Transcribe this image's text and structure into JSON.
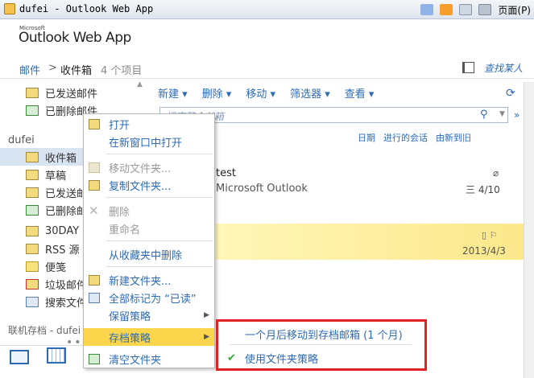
{
  "browser": {
    "tab_title": "dufei - Outlook Web App",
    "page_menu": "页面(P)"
  },
  "header": {
    "ms_label": "Microsoft",
    "brand": "Outlook Web App"
  },
  "breadcrumb": {
    "root": "邮件",
    "separator": ">",
    "current": "收件箱",
    "count": "4 个项目",
    "find_people": "查找某人"
  },
  "nav": {
    "favorites": [
      {
        "label": "已发送邮件"
      },
      {
        "label": "已删除邮件"
      }
    ],
    "account": "dufei",
    "folders": [
      {
        "label": "收件箱"
      },
      {
        "label": "草稿"
      },
      {
        "label": "已发送邮件"
      },
      {
        "label": "已删除邮件"
      },
      {
        "label": "30DAY"
      },
      {
        "label": "RSS 源"
      },
      {
        "label": "便笺"
      },
      {
        "label": "垃圾邮件"
      },
      {
        "label": "搜索文件夹"
      }
    ],
    "archive": "联机存档 - dufei"
  },
  "toolbar": {
    "new": "新建",
    "delete": "删除",
    "move": "移动",
    "filter": "筛选器",
    "view": "查看"
  },
  "search": {
    "placeholder": "搜索整个邮箱"
  },
  "sort": {
    "date": "日期",
    "conversations": "进行的会话",
    "order": "由新到旧"
  },
  "messages": [
    {
      "subject": "test",
      "from": "Microsoft Outlook",
      "date": "三 4/10"
    },
    {
      "date": "2013/4/3"
    }
  ],
  "context_menu": {
    "items": [
      {
        "label": "打开",
        "enabled": true
      },
      {
        "label": "在新窗口中打开",
        "enabled": true
      },
      {
        "label": "移动文件夹...",
        "enabled": false
      },
      {
        "label": "复制文件夹...",
        "enabled": true
      },
      {
        "label": "删除",
        "enabled": false
      },
      {
        "label": "重命名",
        "enabled": false
      },
      {
        "label": "从收藏夹中删除",
        "enabled": true
      },
      {
        "label": "新建文件夹...",
        "enabled": true
      },
      {
        "label": "全部标记为 “已读”",
        "enabled": true
      },
      {
        "label": "保留策略",
        "enabled": true
      },
      {
        "label": "存档策略",
        "enabled": true,
        "highlighted": true
      },
      {
        "label": "清空文件夹",
        "enabled": true
      }
    ]
  },
  "submenu": {
    "items": [
      {
        "label": "一个月后移动到存档邮箱 (1 个月)"
      },
      {
        "label": "使用文件夹策略",
        "checked": true
      }
    ]
  }
}
